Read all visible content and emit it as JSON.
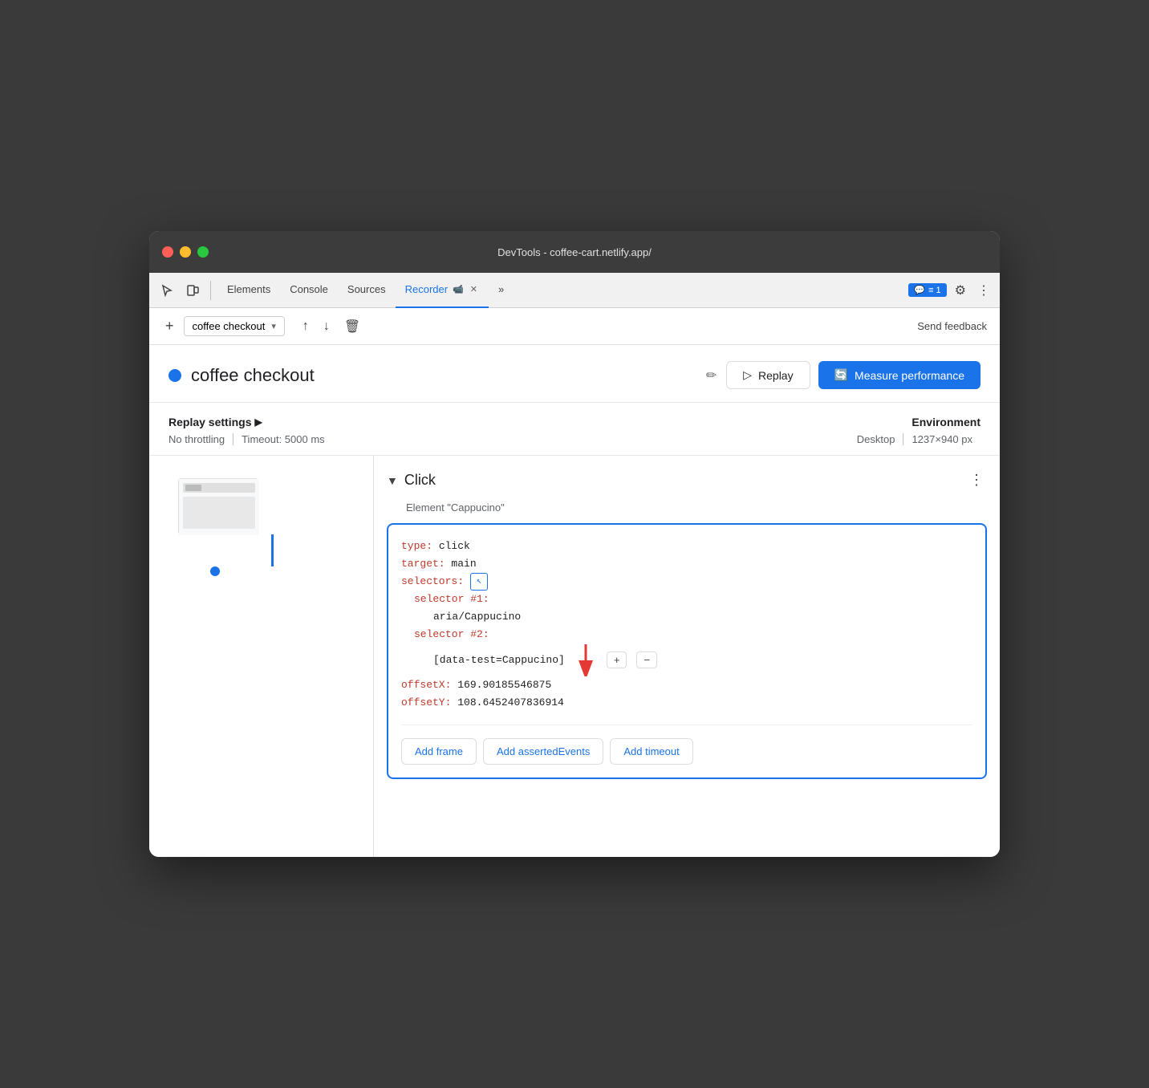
{
  "window": {
    "title": "DevTools - coffee-cart.netlify.app/"
  },
  "tabs": [
    {
      "id": "elements",
      "label": "Elements",
      "active": false
    },
    {
      "id": "console",
      "label": "Console",
      "active": false
    },
    {
      "id": "sources",
      "label": "Sources",
      "active": false
    },
    {
      "id": "recorder",
      "label": "Recorder",
      "active": true
    },
    {
      "id": "more",
      "label": "»",
      "active": false
    }
  ],
  "toolbar": {
    "chat_badge": "≡ 1",
    "send_feedback": "Send feedback"
  },
  "recorder": {
    "add_btn": "+",
    "recording_name": "coffee checkout",
    "replay_label": "Replay",
    "measure_label": "Measure performance",
    "export_icon": "↑",
    "import_icon": "↓",
    "delete_icon": "🗑"
  },
  "recording_header": {
    "title": "coffee checkout",
    "edit_icon": "✏"
  },
  "settings": {
    "label": "Replay settings",
    "arrow": "▶",
    "throttling": "No throttling",
    "timeout": "Timeout: 5000 ms",
    "env_label": "Environment",
    "device": "Desktop",
    "resolution": "1237×940 px"
  },
  "step": {
    "expand_arrow": "▼",
    "name": "Click",
    "subtitle": "Element \"Cappucino\"",
    "more_icon": "⋮",
    "code": {
      "type_key": "type:",
      "type_val": "click",
      "target_key": "target:",
      "target_val": "main",
      "selectors_key": "selectors:",
      "selector1_key": "selector #1:",
      "selector1_val": "aria/Cappucino",
      "selector2_key": "selector #2:",
      "selector2_val": "[data-test=Cappucino]",
      "offsetX_key": "offsetX:",
      "offsetX_val": "169.90185546875",
      "offsetY_key": "offsetY:",
      "offsetY_val": "108.6452407836914"
    },
    "add_frame": "Add frame",
    "add_asserted_events": "Add assertedEvents",
    "add_timeout": "Add timeout"
  }
}
